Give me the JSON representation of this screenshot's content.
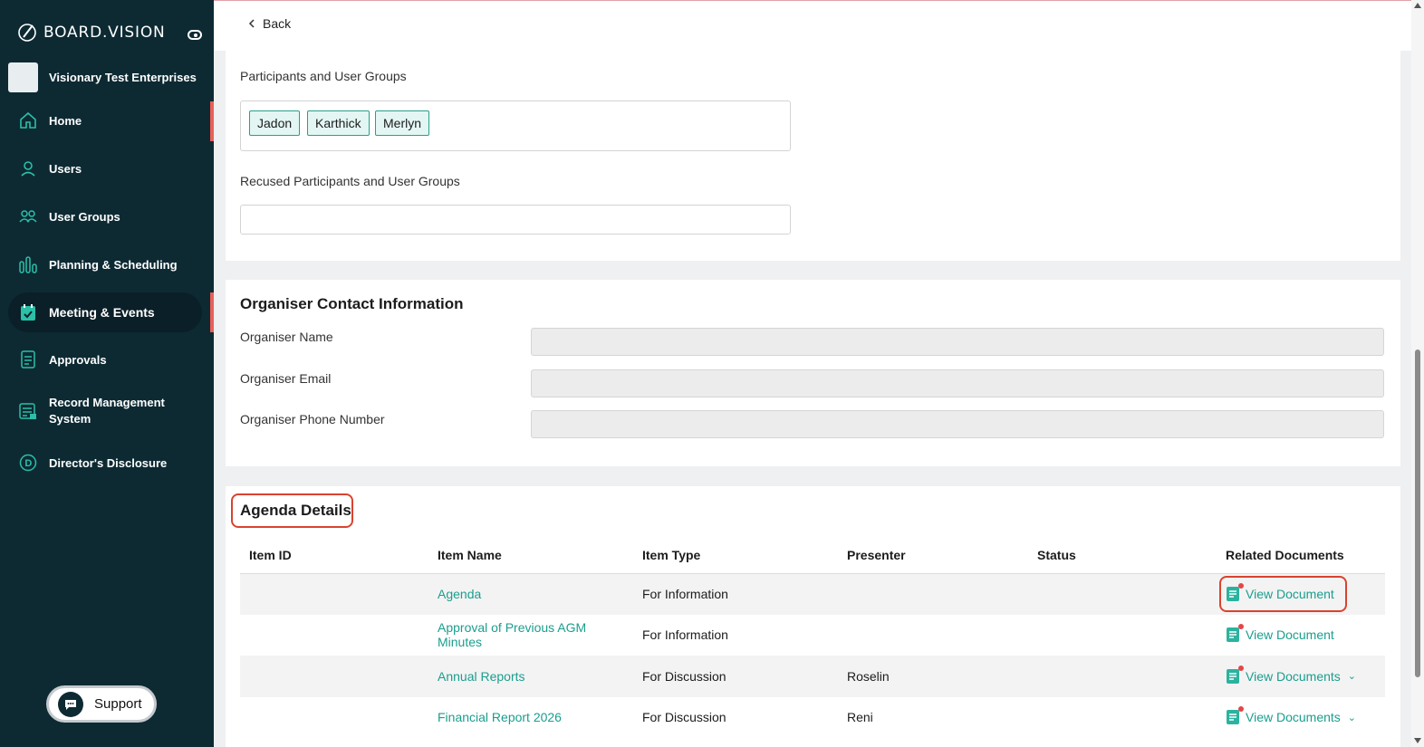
{
  "sidebar": {
    "brand": "BOARD.VISION",
    "org_name": "Visionary Test Enterprises",
    "items": [
      {
        "label": "Home",
        "icon": "home-icon"
      },
      {
        "label": "Users",
        "icon": "user-icon"
      },
      {
        "label": "User Groups",
        "icon": "user-group-icon"
      },
      {
        "label": "Planning & Scheduling",
        "icon": "bar-chart-icon"
      },
      {
        "label": "Meeting & Events",
        "icon": "calendar-check-icon"
      },
      {
        "label": "Approvals",
        "icon": "approvals-icon"
      },
      {
        "label": "Record Management System",
        "icon": "record-icon"
      },
      {
        "label": "Director's Disclosure",
        "icon": "disclosure-icon"
      }
    ],
    "support_label": "Support"
  },
  "topbar": {
    "back_label": "Back"
  },
  "participants": {
    "label": "Participants and User Groups",
    "chips": [
      "Jadon",
      "Karthick",
      "Merlyn"
    ],
    "recused_label": "Recused Participants and User Groups"
  },
  "organiser": {
    "title": "Organiser Contact Information",
    "name_label": "Organiser Name",
    "email_label": "Organiser Email",
    "phone_label": "Organiser Phone Number"
  },
  "agenda": {
    "title": "Agenda Details",
    "columns": [
      "Item ID",
      "Item Name",
      "Item Type",
      "Presenter",
      "Status",
      "Related Documents"
    ],
    "rows": [
      {
        "id": "",
        "name": "Agenda",
        "type": "For Information",
        "presenter": "",
        "status": "",
        "docs": "View Document"
      },
      {
        "id": "",
        "name": "Approval of Previous AGM Minutes",
        "type": "For Information",
        "presenter": "",
        "status": "",
        "docs": "View Document"
      },
      {
        "id": "",
        "name": "Annual Reports",
        "type": "For Discussion",
        "presenter": "Roselin",
        "status": "",
        "docs": "View Documents"
      },
      {
        "id": "",
        "name": "Financial Report 2026",
        "type": "For Discussion",
        "presenter": "Reni",
        "status": "",
        "docs": "View Documents"
      }
    ]
  },
  "colors": {
    "sidebar_bg": "#0d2a33",
    "accent": "#1a9e8e",
    "active_marker": "#e8605a",
    "highlight": "#d9432f"
  }
}
